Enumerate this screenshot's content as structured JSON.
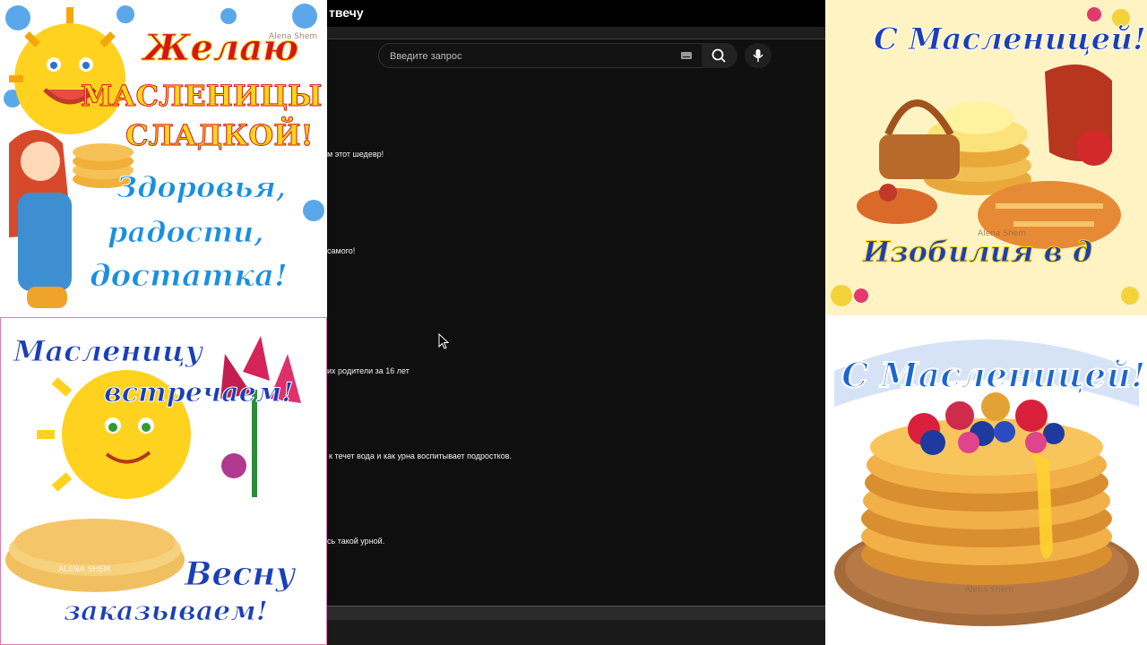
{
  "cards": {
    "top_left": {
      "line1": "Желаю",
      "line2": "масленицы",
      "line3": "сладкой!",
      "line4": "Здоровья,",
      "line5": "радости,",
      "line6": "достатка!",
      "watermark": "Alena Shem"
    },
    "bottom_left": {
      "line1": "Масленицу",
      "line2": "встречаем!",
      "line3": "Весну",
      "line4": "заказываем!",
      "watermark": "ALENA SHEM"
    },
    "top_right": {
      "line1": "С Масленицей!",
      "line2": "Изобилия в д",
      "watermark": "Alena Shem"
    },
    "bottom_right": {
      "line1": "С Масленицей!",
      "watermark": "Alena Shem"
    }
  },
  "app": {
    "title": "твечу",
    "search": {
      "placeholder": "Введите запрос"
    },
    "comments": [
      "м этот шедевр!",
      "самого!",
      "их родители за 16 лет",
      "к течет вода и как урна воспитывает подростков.",
      "сь такой урной."
    ]
  },
  "colors": {
    "app_bg": "#0f0f0f",
    "title_red": "#d4161a",
    "title_blue": "#1b3fb8",
    "title_yellow": "#ffd51a"
  },
  "icons": [
    "keyboard-icon",
    "search-icon",
    "mic-icon",
    "cursor-icon",
    "sun-icon",
    "flower-icon",
    "pancake-icon"
  ]
}
